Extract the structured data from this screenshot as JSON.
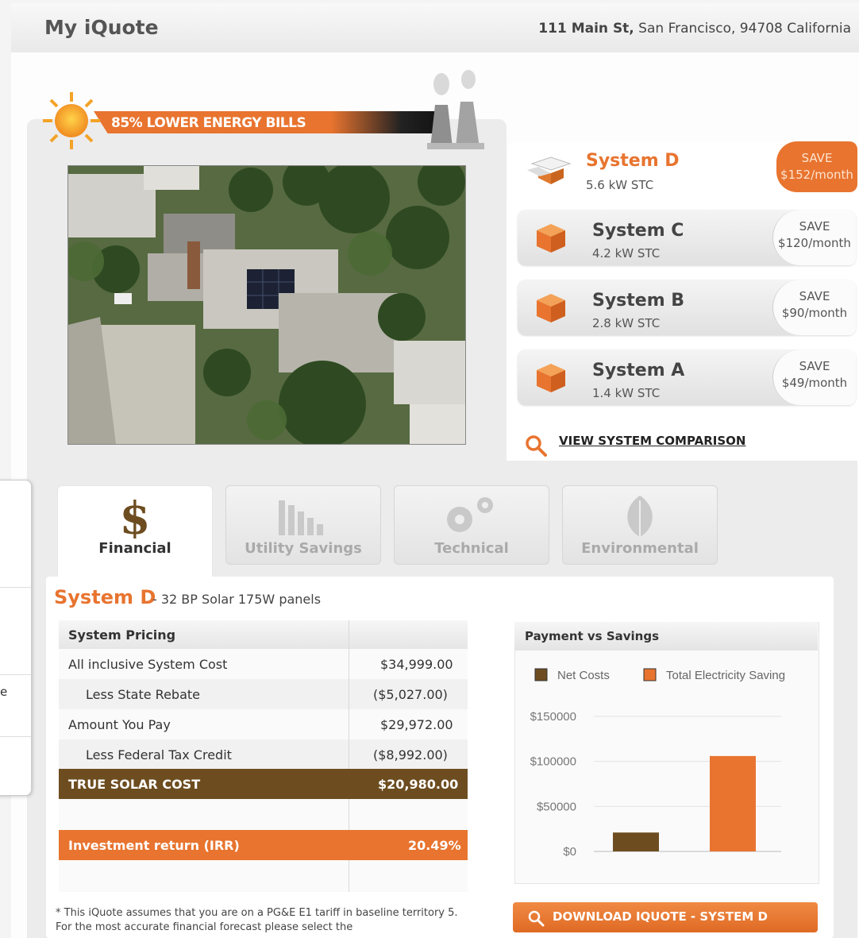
{
  "header": {
    "title": "My iQuote",
    "address_bold": "111 Main St,",
    "address_rest": " San Francisco, 94708 California"
  },
  "banner": {
    "text": "85% LOWER ENERGY BILLS"
  },
  "systems": {
    "active": {
      "name": "System D",
      "kw": "5.6 kW STC",
      "save_label": "SAVE",
      "save_amount": "$152/month"
    },
    "items": [
      {
        "name": "System C",
        "kw": "4.2 kW STC",
        "save_label": "SAVE",
        "save_amount": "$120/month"
      },
      {
        "name": "System B",
        "kw": "2.8 kW STC",
        "save_label": "SAVE",
        "save_amount": "$90/month"
      },
      {
        "name": "System A",
        "kw": "1.4 kW STC",
        "save_label": "SAVE",
        "save_amount": "$49/month"
      }
    ],
    "compare_link": "VIEW SYSTEM COMPARISON"
  },
  "side_popup": {
    "char": "e"
  },
  "tabs": [
    {
      "label": "Financial",
      "icon": "dollar-icon"
    },
    {
      "label": "Utility Savings",
      "icon": "bar-chart-icon"
    },
    {
      "label": "Technical",
      "icon": "gears-icon"
    },
    {
      "label": "Environmental",
      "icon": "leaf-icon"
    }
  ],
  "detail": {
    "system_name": "System D",
    "subtitle": "- 32 BP Solar 175W panels"
  },
  "pricing": {
    "header": "System Pricing",
    "rows": [
      {
        "label": "All inclusive System Cost",
        "value": "$34,999.00"
      },
      {
        "label": "Less State Rebate",
        "value": "($5,027.00)"
      },
      {
        "label": "Amount You Pay",
        "value": "$29,972.00"
      },
      {
        "label": "Less Federal Tax Credit",
        "value": "($8,992.00)"
      }
    ],
    "total_label": "TRUE SOLAR COST",
    "total_value": "$20,980.00",
    "irr_label": "Investment return (IRR)",
    "irr_value": "20.49%"
  },
  "footnote": "* This iQuote assumes that you are on a PG&E E1 tariff in baseline territory 5. For the most accurate financial forecast please select the",
  "chart_data": {
    "type": "bar",
    "title": "Payment vs Savings",
    "categories": [
      ""
    ],
    "series": [
      {
        "name": "Net Costs",
        "values": [
          21000
        ],
        "color": "#6d4d20"
      },
      {
        "name": "Total Electricity Saving",
        "values": [
          106000
        ],
        "color": "#e8742f"
      }
    ],
    "yticks": [
      "$0",
      "$50000",
      "$100000",
      "$150000"
    ],
    "ylim": [
      0,
      150000
    ],
    "legend": "top",
    "grid": true
  },
  "download": {
    "label": "DOWNLOAD IQUOTE - SYSTEM D"
  },
  "colors": {
    "accent": "#e8742f",
    "brown": "#6d4d20"
  }
}
